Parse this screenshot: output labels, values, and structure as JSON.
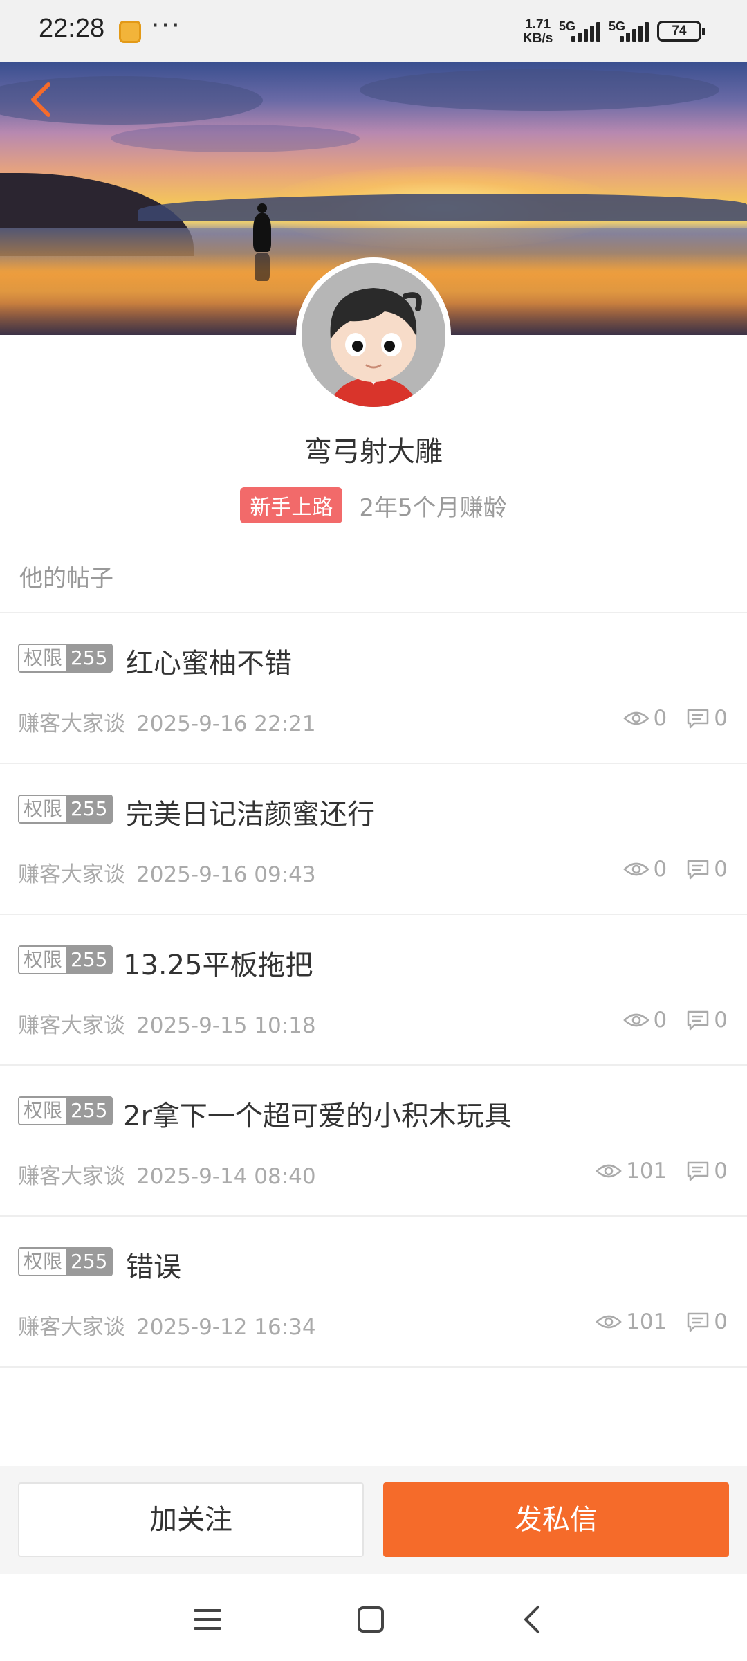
{
  "status_bar": {
    "time": "22:28",
    "more": "···",
    "speed_value": "1.71",
    "speed_unit": "KB/s",
    "network_1": "5G",
    "network_2": "5G",
    "battery": "74"
  },
  "profile": {
    "username": "弯弓射大雕",
    "level_badge": "新手上路",
    "tenure": "2年5个月赚龄",
    "badge_color": "#f26a6a"
  },
  "posts_section": {
    "title": "他的帖子",
    "posts": [
      {
        "perm_label": "权限",
        "perm_level": "255",
        "title": "红心蜜柚不错",
        "forum": "赚客大家谈",
        "date": "2025-9-16 22:21",
        "views": "0",
        "comments": "0"
      },
      {
        "perm_label": "权限",
        "perm_level": "255",
        "title": "完美日记洁颜蜜还行",
        "forum": "赚客大家谈",
        "date": "2025-9-16 09:43",
        "views": "0",
        "comments": "0"
      },
      {
        "perm_label": "权限",
        "perm_level": "255",
        "title": "13.25平板拖把",
        "forum": "赚客大家谈",
        "date": "2025-9-15 10:18",
        "views": "0",
        "comments": "0"
      },
      {
        "perm_label": "权限",
        "perm_level": "255",
        "title": "2r拿下一个超可爱的小积木玩具",
        "forum": "赚客大家谈",
        "date": "2025-9-14 08:40",
        "views": "101",
        "comments": "0"
      },
      {
        "perm_label": "权限",
        "perm_level": "255",
        "title": "错误",
        "forum": "赚客大家谈",
        "date": "2025-9-12 16:34",
        "views": "101",
        "comments": "0"
      }
    ]
  },
  "actions": {
    "follow_label": "加关注",
    "message_label": "发私信",
    "accent": "#f56b2a"
  },
  "icons": {
    "back": "back-arrow-icon",
    "views": "eye-icon",
    "comments": "comment-icon",
    "nav_menu": "menu-icon",
    "nav_home": "home-square-icon",
    "nav_back": "back-chevron-icon"
  }
}
